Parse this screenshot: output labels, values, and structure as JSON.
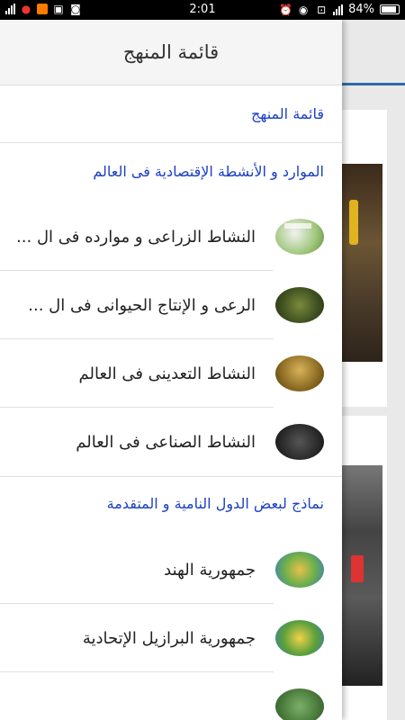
{
  "status_bar": {
    "time": "2:01",
    "battery": "84%"
  },
  "drawer": {
    "header_title": "قائمة المنهج",
    "section_curriculum": "قائمة المنهج",
    "section_resources": "الموارد و الأنشطة الإقتصادية فى العالم",
    "resource_items": [
      {
        "label": "النشاط الزراعى و موارده فى ال ...",
        "icon": "agriculture-thumbnail"
      },
      {
        "label": "الرعى و الإنتاج الحيوانى فى ال ...",
        "icon": "livestock-thumbnail"
      },
      {
        "label": "النشاط التعدينى فى العالم",
        "icon": "mining-thumbnail"
      },
      {
        "label": "النشاط الصناعى فى العالم",
        "icon": "industry-thumbnail"
      }
    ],
    "section_countries": "نماذج لبعض الدول النامية و المتقدمة",
    "country_items": [
      {
        "label": "جمهورية الهند",
        "icon": "india-map-thumbnail"
      },
      {
        "label": "جمهورية البرازيل الإتحادية",
        "icon": "brazil-map-thumbnail"
      },
      {
        "label": "",
        "icon": "map-thumbnail"
      }
    ]
  },
  "colors": {
    "section_heading": "#1a3fc4",
    "drawer_header_bg": "#f5f5f5",
    "status_bar_bg": "#000000"
  }
}
